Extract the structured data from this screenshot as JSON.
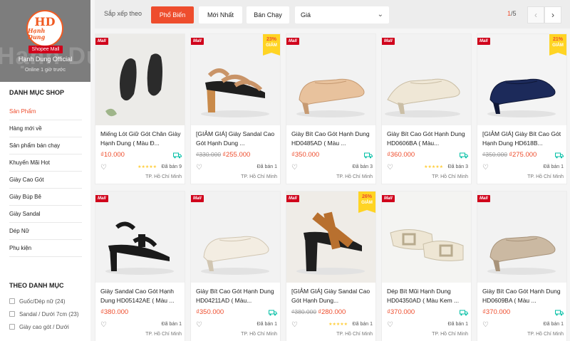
{
  "shop": {
    "ghost_text": "Hạnh Dung",
    "logo_mono": "HD",
    "logo_brand": "Hạnh Dung",
    "mall_label": "Shopee Mall",
    "name": "Hạnh Dung Official",
    "status": "Online 1 giờ trước"
  },
  "sidebar": {
    "category_title": "DANH MỤC SHOP",
    "categories": [
      {
        "label": "Sản Phẩm",
        "active": true
      },
      {
        "label": "Hàng mới về"
      },
      {
        "label": "Sản phẩm bán chạy"
      },
      {
        "label": "Khuyến Mãi Hot"
      },
      {
        "label": "Giày Cao Gót"
      },
      {
        "label": "Giày Búp Bê"
      },
      {
        "label": "Giày Sandal"
      },
      {
        "label": "Dép Nữ"
      },
      {
        "label": "Phụ kiện"
      }
    ],
    "filter_title": "THEO DANH MỤC",
    "filters": [
      {
        "label": "Guốc/Dép nữ (24)"
      },
      {
        "label": "Sandal / Dưới 7cm (23)"
      },
      {
        "label": "Giày cao gót / Dưới"
      }
    ]
  },
  "sortbar": {
    "label": "Sắp xếp theo",
    "options": [
      "Phổ Biến",
      "Mới Nhất",
      "Bán Chạy"
    ],
    "active_index": 0,
    "price_select": "Giá",
    "page_current": "1",
    "page_total": "/5",
    "prev_icon": "chevron-left-icon",
    "next_icon": "chevron-right-icon"
  },
  "colors": {
    "accent": "#ee4d2d",
    "mall_red": "#d0011b",
    "discount_yellow": "#ffd424",
    "free_ship_green": "#00bfa5"
  },
  "mall_badge": "Mall",
  "discount_badge_label": "GIẢM",
  "products": [
    {
      "name": "Miếng Lót Giữ Gót Chân Giày Hạnh Dung ( Màu Đ...",
      "old_price": "",
      "price": "₫10.000",
      "discount": "",
      "rating": 5,
      "sold": "Đã bán 9",
      "location": "TP. Hồ Chí Minh",
      "image": "insoles",
      "free_ship": true
    },
    {
      "name": "[GIẢM GIÁ] Giày Sandal Cao Gót Hạnh Dung ...",
      "old_price": "₫330.000",
      "price": "₫255.000",
      "discount": "23%",
      "rating": 0,
      "sold": "Đã bán 1",
      "location": "TP. Hồ Chí Minh",
      "image": "sandal-tan",
      "free_ship": false
    },
    {
      "name": "Giày Bít Cao Gót Hạnh Dung HD0485AD ( Màu ...",
      "old_price": "",
      "price": "₫350.000",
      "discount": "",
      "rating": 0,
      "sold": "Đã bán 3",
      "location": "TP. Hồ Chí Minh",
      "image": "pump-nude",
      "free_ship": true
    },
    {
      "name": "Giày Bít Cao Gót Hạnh Dung HD0606BA ( Màu...",
      "old_price": "",
      "price": "₫360.000",
      "discount": "",
      "rating": 5,
      "sold": "Đã bán 3",
      "location": "TP. Hồ Chí Minh",
      "image": "pump-cream",
      "free_ship": true
    },
    {
      "name": "[GIẢM GIÁ] Giày Bít Cao Gót Hạnh Dung HD618B...",
      "old_price": "₫350.000",
      "price": "₫275.000",
      "discount": "21%",
      "rating": 0,
      "sold": "Đã bán 1",
      "location": "TP. Hồ Chí Minh",
      "image": "pump-navy",
      "free_ship": true
    },
    {
      "name": "Giày Sandal Cao Gót Hạnh Dung HD05142AE ( Màu ...",
      "old_price": "",
      "price": "₫380.000",
      "discount": "",
      "rating": 0,
      "sold": "Đã bán 1",
      "location": "TP. Hồ Chí Minh",
      "image": "sandal-black",
      "free_ship": false
    },
    {
      "name": "Giày Bít Cao Gót Hạnh Dung HD04211AD ( Màu...",
      "old_price": "",
      "price": "₫350.000",
      "discount": "",
      "rating": 0,
      "sold": "Đã bán 1",
      "location": "TP. Hồ Chí Minh",
      "image": "pump-white",
      "free_ship": true
    },
    {
      "name": "[GIẢM GIÁ] Giày Sandal Cao Gót Hạnh Dung...",
      "old_price": "₫380.000",
      "price": "₫280.000",
      "discount": "26%",
      "rating": 5,
      "sold": "Đã bán 1",
      "location": "TP. Hồ Chí Minh",
      "image": "sandal-cognac",
      "free_ship": false
    },
    {
      "name": "Dép Bít Mũi Hạnh Dung HD04350AD ( Màu Kem ...",
      "old_price": "",
      "price": "₫370.000",
      "discount": "",
      "rating": 0,
      "sold": "Đã bán 1",
      "location": "TP. Hồ Chí Minh",
      "image": "mule-cream",
      "free_ship": true
    },
    {
      "name": "Giày Bít Cao Gót Hạnh Dung HD0609BA ( Màu ...",
      "old_price": "",
      "price": "₫370.000",
      "discount": "",
      "rating": 0,
      "sold": "Đã bán 1",
      "location": "TP. Hồ Chí Minh",
      "image": "pump-taupe",
      "free_ship": true
    }
  ]
}
